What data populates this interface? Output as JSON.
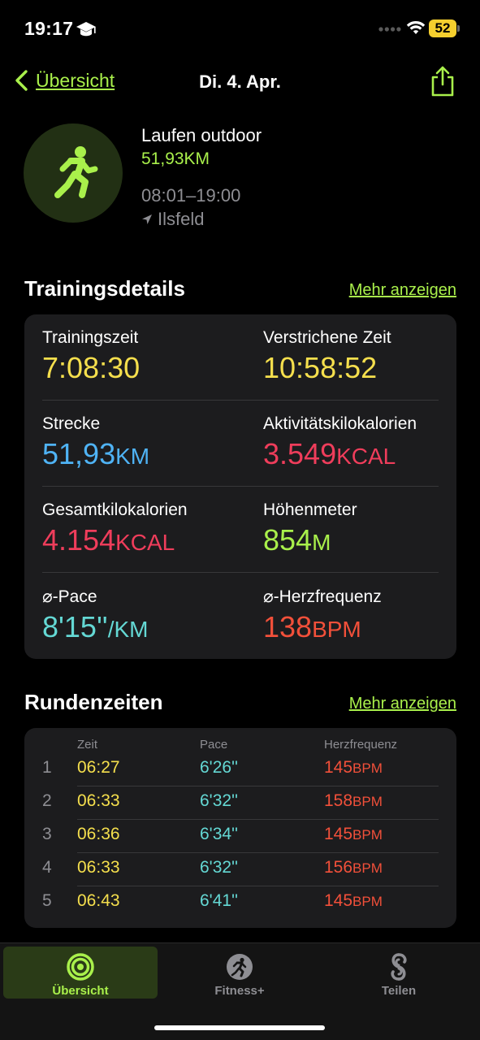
{
  "status_bar": {
    "time": "19:17",
    "battery": "52",
    "icons": [
      "graduation-cap-icon",
      "signal-dots-icon",
      "wifi-icon",
      "battery-icon"
    ]
  },
  "nav": {
    "back_label": "Übersicht",
    "title": "Di. 4. Apr."
  },
  "workout": {
    "type": "Laufen outdoor",
    "distance": "51,93KM",
    "time_range": "08:01–19:00",
    "location": "Ilsfeld"
  },
  "details": {
    "section_title": "Trainingsdetails",
    "more_label": "Mehr anzeigen",
    "rows": [
      {
        "left": {
          "label": "Trainingszeit",
          "value": "7:08:30",
          "unit": ""
        },
        "right": {
          "label": "Verstrichene Zeit",
          "value": "10:58:52",
          "unit": ""
        }
      },
      {
        "left": {
          "label": "Strecke",
          "value": "51,93",
          "unit": "KM"
        },
        "right": {
          "label": "Aktivitätskilokalorien",
          "value": "3.549",
          "unit": "KCAL"
        }
      },
      {
        "left": {
          "label": "Gesamtkilokalorien",
          "value": "4.154",
          "unit": "KCAL"
        },
        "right": {
          "label": "Höhenmeter",
          "value": "854",
          "unit": "M"
        }
      },
      {
        "left": {
          "label": "⌀-Pace",
          "value": "8'15''",
          "unit": "/KM"
        },
        "right": {
          "label": "⌀-Herzfrequenz",
          "value": "138",
          "unit": "BPM"
        }
      }
    ],
    "colors": {
      "yellow": "#f5df4d",
      "blue": "#4fb3f5",
      "pink": "#ef3d5b",
      "green": "#a9f04b",
      "cyan": "#64d8d4",
      "red": "#f2503a"
    }
  },
  "laps": {
    "section_title": "Rundenzeiten",
    "more_label": "Mehr anzeigen",
    "headers": {
      "time": "Zeit",
      "pace": "Pace",
      "hr": "Herzfrequenz"
    },
    "hr_unit": "BPM",
    "rows": [
      {
        "num": "1",
        "time": "06:27",
        "pace": "6'26''",
        "hr": "145"
      },
      {
        "num": "2",
        "time": "06:33",
        "pace": "6'32''",
        "hr": "158"
      },
      {
        "num": "3",
        "time": "06:36",
        "pace": "6'34''",
        "hr": "145"
      },
      {
        "num": "4",
        "time": "06:33",
        "pace": "6'32''",
        "hr": "156"
      },
      {
        "num": "5",
        "time": "06:43",
        "pace": "6'41''",
        "hr": "145"
      }
    ]
  },
  "tabbar": {
    "tabs": [
      {
        "label": "Übersicht",
        "icon": "activity-rings-icon",
        "active": true
      },
      {
        "label": "Fitness+",
        "icon": "fitness-plus-icon",
        "active": false
      },
      {
        "label": "Teilen",
        "icon": "sharing-icon",
        "active": false
      }
    ]
  }
}
